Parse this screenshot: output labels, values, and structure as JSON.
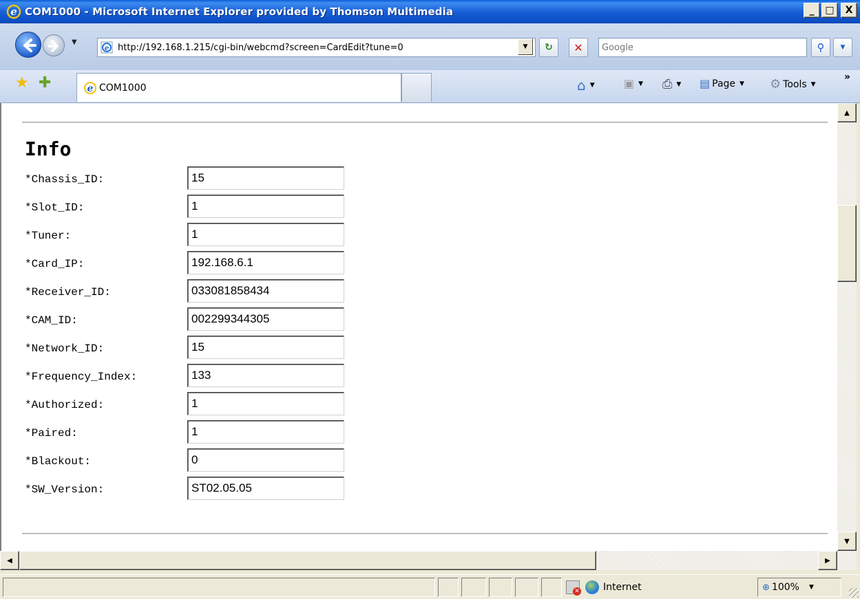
{
  "window": {
    "title": "COM1000 - Microsoft Internet Explorer provided by Thomson Multimedia",
    "minimize_label": "_",
    "maximize_label": "□",
    "close_label": "X"
  },
  "address": {
    "url": "http://192.168.1.215/cgi-bin/webcmd?screen=CardEdit?tune=0"
  },
  "search": {
    "placeholder": "Google"
  },
  "tab": {
    "label": "COM1000"
  },
  "commands": {
    "page_label": "Page",
    "tools_label": "Tools",
    "more": "»"
  },
  "page": {
    "heading": "Info",
    "fields": [
      {
        "label": "*Chassis_ID:",
        "value": "15"
      },
      {
        "label": "*Slot_ID:",
        "value": "1"
      },
      {
        "label": "*Tuner:",
        "value": "1"
      },
      {
        "label": "*Card_IP:",
        "value": "192.168.6.1"
      },
      {
        "label": "*Receiver_ID:",
        "value": "033081858434"
      },
      {
        "label": "*CAM_ID:",
        "value": "002299344305"
      },
      {
        "label": "*Network_ID:",
        "value": "15"
      },
      {
        "label": "*Frequency_Index:",
        "value": "133"
      },
      {
        "label": "*Authorized:",
        "value": "1"
      },
      {
        "label": "*Paired:",
        "value": "1"
      },
      {
        "label": "*Blackout:",
        "value": "0"
      },
      {
        "label": "*SW_Version:",
        "value": "ST02.05.05"
      }
    ]
  },
  "status": {
    "zone": "Internet",
    "zoom": "100%"
  },
  "colors": {
    "titlebar": "#0a5fd8",
    "chrome": "#ece9d8",
    "toolbar": "#c7d6ee"
  }
}
